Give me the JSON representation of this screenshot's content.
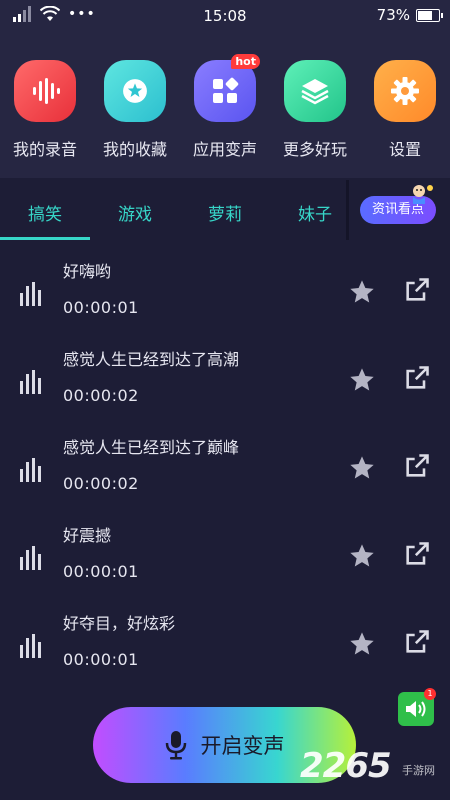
{
  "status_bar": {
    "time": "15:08",
    "battery": "73%",
    "battery_level": 0.73
  },
  "menu": [
    {
      "label": "我的录音",
      "icon": "waveform-icon",
      "color": "#ff4d4d"
    },
    {
      "label": "我的收藏",
      "icon": "star-icon",
      "color": "#3ed3d6"
    },
    {
      "label": "应用变声",
      "icon": "apps-icon",
      "color": "#6b67ff",
      "badge": "hot"
    },
    {
      "label": "更多好玩",
      "icon": "layers-icon",
      "color": "#38d8a0"
    },
    {
      "label": "设置",
      "icon": "gear-icon",
      "color": "#ff9a3c"
    }
  ],
  "tabs": [
    {
      "label": "搞笑",
      "active": true
    },
    {
      "label": "游戏"
    },
    {
      "label": "萝莉"
    },
    {
      "label": "妹子"
    }
  ],
  "news_button": "资讯看点",
  "sounds": [
    {
      "title": "好嗨哟",
      "duration": "00:00:01"
    },
    {
      "title": "感觉人生已经到达了高潮",
      "duration": "00:00:02"
    },
    {
      "title": "感觉人生已经到达了巅峰",
      "duration": "00:00:02"
    },
    {
      "title": "好震撼",
      "duration": "00:00:01"
    },
    {
      "title": "好夺目，好炫彩",
      "duration": "00:00:01"
    }
  ],
  "record_button": "开启变声",
  "speaker_badge": "1",
  "watermark": {
    "main": "2265",
    "sub": "手游网"
  },
  "colors": {
    "accent": "#37d6c8",
    "background": "#1d1d36",
    "header": "#262642"
  }
}
